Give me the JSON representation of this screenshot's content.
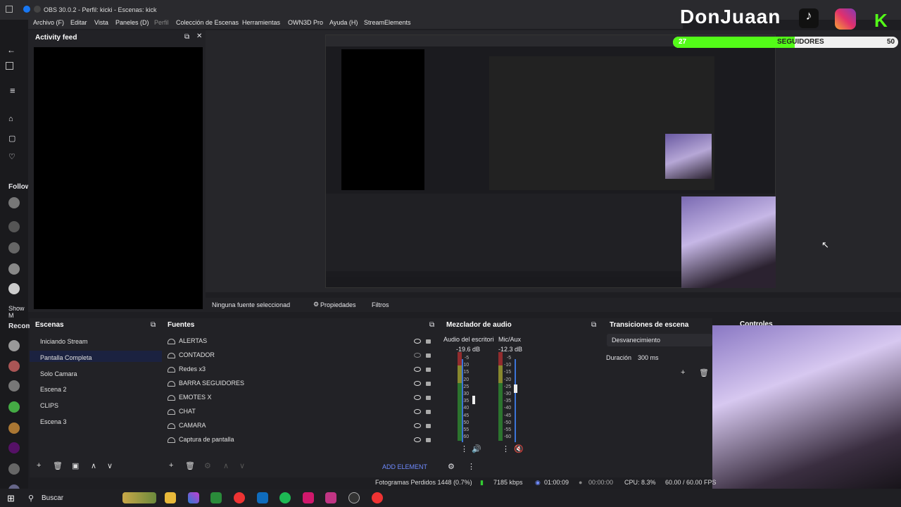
{
  "window": {
    "title": "OBS 30.0.2 - Perfil: kicki - Escenas: kick"
  },
  "menu": [
    "Archivo (F)",
    "Editar",
    "Vista",
    "Paneles (D)",
    "Perfil",
    "Colección de Escenas",
    "Herramientas",
    "OWN3D Pro",
    "Ayuda (H)",
    "StreamElements"
  ],
  "browser_sidebar": {
    "following_label": "Follow",
    "show_more": "Show M",
    "recommended_label": "Recom"
  },
  "activity_feed": {
    "title": "Activity feed"
  },
  "overlay": {
    "streamer_name": "DonJuaan",
    "followers_label": "SEGUIDORES",
    "followers_count": "27",
    "followers_goal": "50"
  },
  "properties_bar": {
    "no_source": "Ninguna fuente seleccionad",
    "properties": "Propiedades",
    "filters": "Filtros"
  },
  "scenes": {
    "title": "Escenas",
    "items": [
      "Iniciando Stream",
      "Pantalla Completa",
      "Solo Camara",
      "Escena 2",
      "CLIPS",
      "Escena 3"
    ],
    "selected": "Pantalla Completa"
  },
  "sources": {
    "title": "Fuentes",
    "items": [
      "ALERTAS",
      "CONTADOR",
      "Redes x3",
      "BARRA SEGUIDORES",
      "EMOTES X",
      "CHAT",
      "CAMARA",
      "Captura de pantalla"
    ],
    "add_element": "ADD ELEMENT"
  },
  "mixer": {
    "title": "Mezclador de audio",
    "channels": [
      {
        "name": "Audio del escritorio",
        "db": "-19.6 dB"
      },
      {
        "name": "Mic/Aux",
        "db": "-12.3 dB"
      }
    ],
    "scale": [
      "-5",
      "-10",
      "-15",
      "-20",
      "-25",
      "-30",
      "-35",
      "-40",
      "-45",
      "-50",
      "-55",
      "-60"
    ]
  },
  "transitions": {
    "title": "Transiciones de escena",
    "selected": "Desvanecimiento",
    "duration_label": "Duración",
    "duration_value": "300 ms"
  },
  "controls": {
    "title": "Controles"
  },
  "status": {
    "dropped": "Fotogramas Perdidos 1448 (0.7%)",
    "bitrate": "7185 kbps",
    "stream_time": "01:00:09",
    "rec_time": "00:00:00",
    "cpu": "CPU: 8.3%",
    "fps": "60.00 / 60.00 FPS"
  },
  "taskbar": {
    "search_placeholder": "Buscar"
  }
}
